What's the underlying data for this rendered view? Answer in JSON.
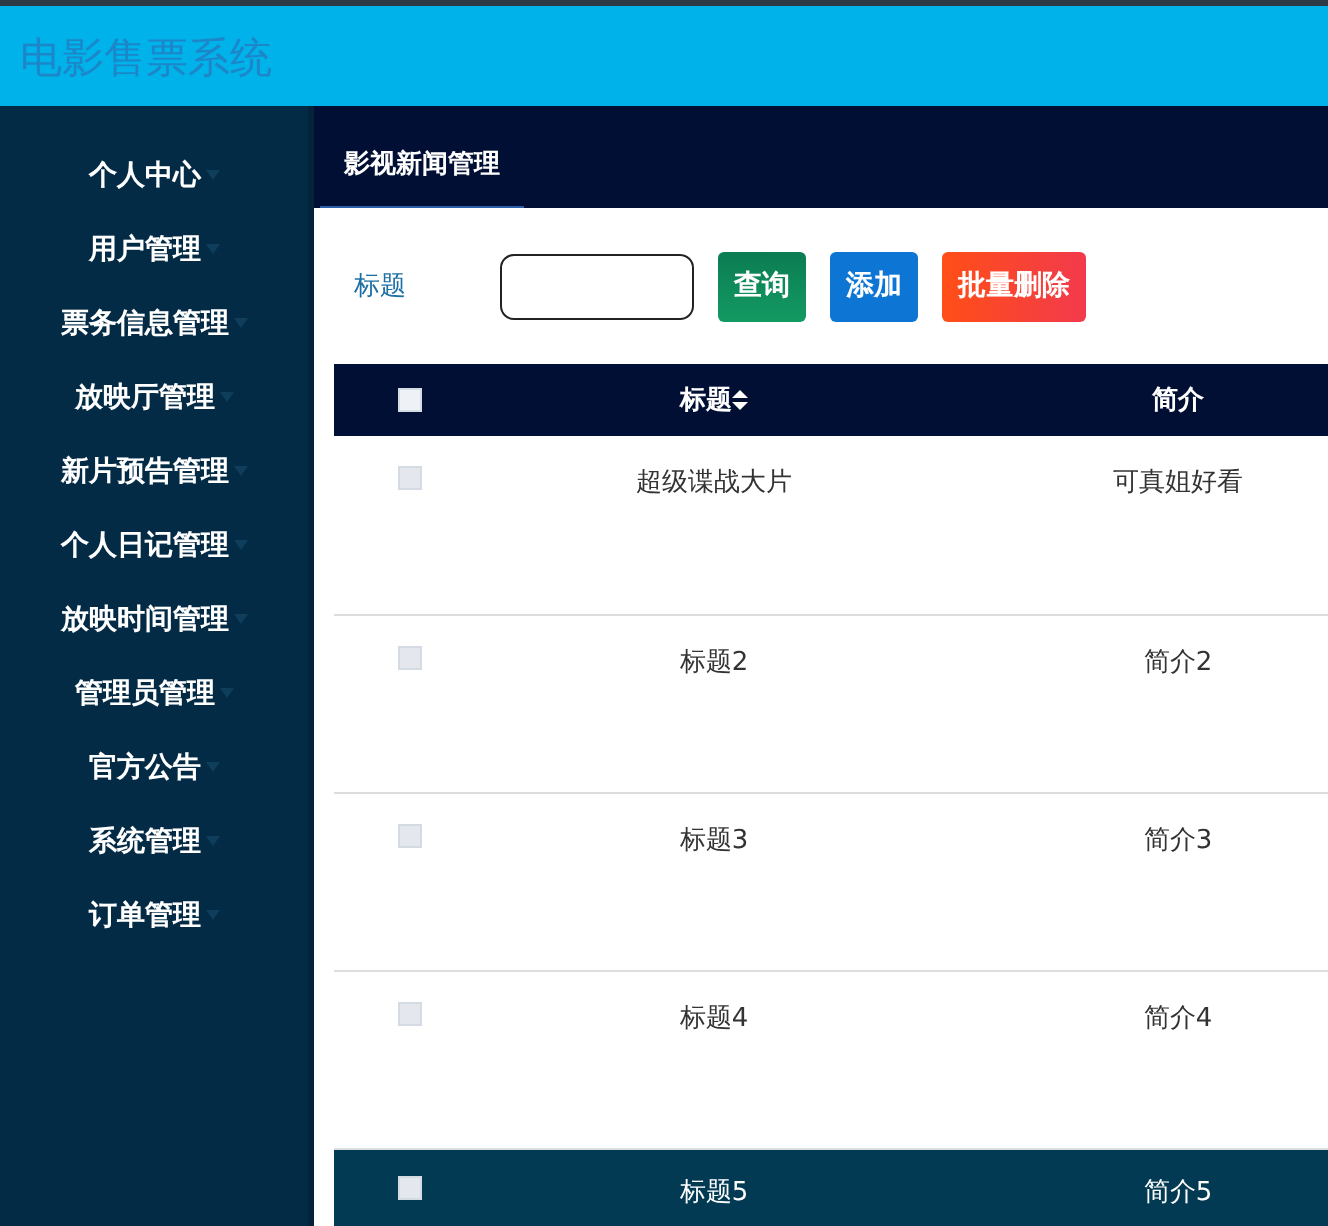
{
  "app_title": "电影售票系统",
  "sidebar": {
    "items": [
      {
        "label": "个人中心"
      },
      {
        "label": "用户管理"
      },
      {
        "label": "票务信息管理"
      },
      {
        "label": "放映厅管理"
      },
      {
        "label": "新片预告管理"
      },
      {
        "label": "个人日记管理"
      },
      {
        "label": "放映时间管理"
      },
      {
        "label": "管理员管理"
      },
      {
        "label": "官方公告"
      },
      {
        "label": "系统管理"
      },
      {
        "label": "订单管理"
      }
    ]
  },
  "tabs": [
    {
      "label": "影视新闻管理",
      "selected": true
    }
  ],
  "search": {
    "label": "标题"
  },
  "buttons": [
    {
      "label": "查询",
      "kind": "search"
    },
    {
      "label": "添加",
      "kind": "add"
    },
    {
      "label": "批量删除",
      "kind": "delete"
    }
  ],
  "table": {
    "header_checked": false,
    "columns": [
      {
        "label": "标题",
        "sortable": true
      },
      {
        "label": "简介",
        "sortable": false
      }
    ],
    "rows": [
      {
        "checked": false,
        "selected": false,
        "cells": [
          "超级谍战大片",
          "可真姐好看"
        ]
      },
      {
        "checked": false,
        "selected": false,
        "cells": [
          "标题2",
          "简介2"
        ]
      },
      {
        "checked": false,
        "selected": false,
        "cells": [
          "标题3",
          "简介3"
        ]
      },
      {
        "checked": false,
        "selected": false,
        "cells": [
          "标题4",
          "简介4"
        ]
      },
      {
        "checked": false,
        "selected": true,
        "cells": [
          "标题5",
          "简介5"
        ]
      }
    ]
  }
}
